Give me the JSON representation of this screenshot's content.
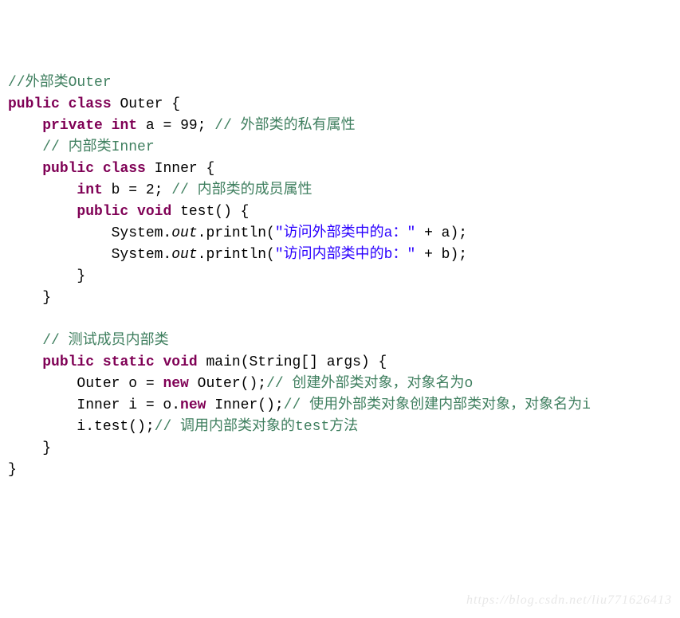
{
  "lines": [
    [
      {
        "t": "//外部类Outer",
        "c": "cm"
      }
    ],
    [
      {
        "t": "public",
        "c": "kw"
      },
      {
        "t": " "
      },
      {
        "t": "class",
        "c": "kw"
      },
      {
        "t": " Outer {"
      }
    ],
    [
      {
        "t": "    "
      },
      {
        "t": "private",
        "c": "kw"
      },
      {
        "t": " "
      },
      {
        "t": "int",
        "c": "kw"
      },
      {
        "t": " a = 99; "
      },
      {
        "t": "// 外部类的私有属性",
        "c": "cm"
      }
    ],
    [
      {
        "t": "    "
      },
      {
        "t": "// 内部类Inner",
        "c": "cm"
      }
    ],
    [
      {
        "t": "    "
      },
      {
        "t": "public",
        "c": "kw"
      },
      {
        "t": " "
      },
      {
        "t": "class",
        "c": "kw"
      },
      {
        "t": " Inner {"
      }
    ],
    [
      {
        "t": "        "
      },
      {
        "t": "int",
        "c": "kw"
      },
      {
        "t": " b = 2; "
      },
      {
        "t": "// 内部类的成员属性",
        "c": "cm"
      }
    ],
    [
      {
        "t": "        "
      },
      {
        "t": "public",
        "c": "kw"
      },
      {
        "t": " "
      },
      {
        "t": "void",
        "c": "kw"
      },
      {
        "t": " test() {"
      }
    ],
    [
      {
        "t": "            System."
      },
      {
        "t": "out",
        "c": "it"
      },
      {
        "t": ".println("
      },
      {
        "t": "\"访问外部类中的a：\"",
        "c": "str"
      },
      {
        "t": " + a);"
      }
    ],
    [
      {
        "t": "            System."
      },
      {
        "t": "out",
        "c": "it"
      },
      {
        "t": ".println("
      },
      {
        "t": "\"访问内部类中的b：\"",
        "c": "str"
      },
      {
        "t": " + b);"
      }
    ],
    [
      {
        "t": "        }"
      }
    ],
    [
      {
        "t": "    }"
      }
    ],
    [
      {
        "t": ""
      }
    ],
    [
      {
        "t": "    "
      },
      {
        "t": "// 测试成员内部类",
        "c": "cm"
      }
    ],
    [
      {
        "t": "    "
      },
      {
        "t": "public",
        "c": "kw"
      },
      {
        "t": " "
      },
      {
        "t": "static",
        "c": "kw"
      },
      {
        "t": " "
      },
      {
        "t": "void",
        "c": "kw"
      },
      {
        "t": " main(String[] args) {"
      }
    ],
    [
      {
        "t": "        Outer o = "
      },
      {
        "t": "new",
        "c": "kw"
      },
      {
        "t": " Outer();"
      },
      {
        "t": "// 创建外部类对象，对象名为o",
        "c": "cm"
      }
    ],
    [
      {
        "t": "        Inner i = o."
      },
      {
        "t": "new",
        "c": "kw"
      },
      {
        "t": " Inner();"
      },
      {
        "t": "// 使用外部类对象创建内部类对象，对象名为i",
        "c": "cm"
      }
    ],
    [
      {
        "t": "        i.test();"
      },
      {
        "t": "// 调用内部类对象的test方法",
        "c": "cm"
      }
    ],
    [
      {
        "t": "    }"
      }
    ],
    [
      {
        "t": "}"
      }
    ]
  ],
  "watermark": "https://blog.csdn.net/liu771626413"
}
